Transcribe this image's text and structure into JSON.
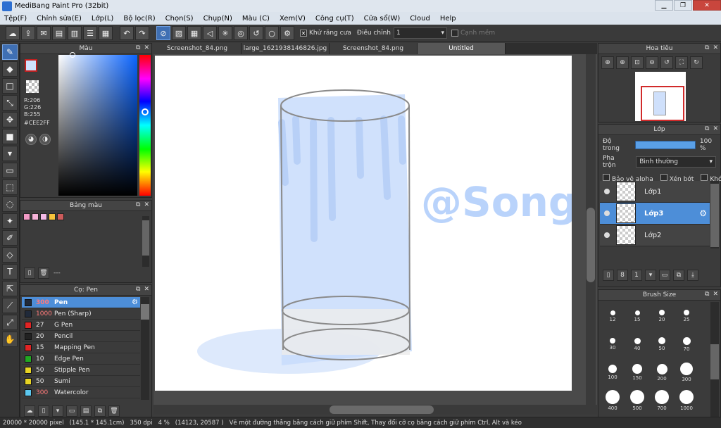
{
  "window": {
    "title": "MediBang Paint Pro (32bit)",
    "minimize": "▁",
    "maximize": "❐",
    "close": "✕"
  },
  "menu": [
    "Tệp(F)",
    "Chỉnh sửa(E)",
    "Lớp(L)",
    "Bộ lọc(R)",
    "Chọn(S)",
    "Chụp(N)",
    "Màu (C)",
    "Xem(V)",
    "Công cụ(T)",
    "Cửa sổ(W)",
    "Cloud",
    "Help"
  ],
  "toolbar": {
    "antialias_label": "Khử răng cưa",
    "correction_label": "Điều chỉnh",
    "correction_value": "1",
    "soft_edge_label": "Cạnh mềm"
  },
  "color_panel": {
    "title": "Màu",
    "r": "R:206",
    "g": "G:226",
    "b": "B:255",
    "hex": "#CEE2FF",
    "fg_color": "#CEE2FF"
  },
  "palette_panel": {
    "title": "Bảng màu",
    "swatches": [
      "#f29ac5",
      "#f5b2d8",
      "#f3b9e6",
      "#f7c33b",
      "#cc5b5b"
    ],
    "footer_text": "---"
  },
  "brush_panel": {
    "title": "Cọ: Pen",
    "brushes": [
      {
        "size": "300",
        "name": "Pen",
        "color": "#202a3a"
      },
      {
        "size": "1000",
        "name": "Pen (Sharp)",
        "color": "#202a3a"
      },
      {
        "size": "27",
        "name": "G Pen",
        "color": "#e02424"
      },
      {
        "size": "20",
        "name": "Pencil",
        "color": "#222222"
      },
      {
        "size": "15",
        "name": "Mapping Pen",
        "color": "#e02424"
      },
      {
        "size": "10",
        "name": "Edge Pen",
        "color": "#22a822"
      },
      {
        "size": "50",
        "name": "Stipple Pen",
        "color": "#e8d424"
      },
      {
        "size": "50",
        "name": "Sumi",
        "color": "#e8d424"
      },
      {
        "size": "300",
        "name": "Watercolor",
        "color": "#5cc8f0"
      }
    ]
  },
  "tabs": [
    "Screenshot_84.png",
    "large_1621938146826.jpg",
    "Screenshot_84.png",
    "Untitled"
  ],
  "canvas": {
    "signature": "@Song"
  },
  "navigator": {
    "title": "Hoa tiêu"
  },
  "layer_panel": {
    "title": "Lớp",
    "opacity_label": "Độ trong",
    "opacity_value": "100 %",
    "blend_label": "Pha trộn",
    "blend_value": "Bình thường",
    "protect_alpha": "Bảo vệ alpha",
    "clipping": "Xén bớt",
    "lock": "Khóa",
    "layers": [
      "Lớp1",
      "Lớp3",
      "Lớp2"
    ]
  },
  "brush_size_panel": {
    "title": "Brush Size",
    "sizes": [
      "12",
      "15",
      "20",
      "25",
      "30",
      "40",
      "50",
      "70",
      "100",
      "150",
      "200",
      "300",
      "400",
      "500",
      "700",
      "1000"
    ]
  },
  "statusbar": {
    "size": "20000 * 20000 pixel",
    "cm": "(145.1 * 145.1cm)",
    "dpi": "350 dpi",
    "zoom": "4 %",
    "coords": "(14123, 20587 )",
    "hint": "Vẽ một đường thẳng bằng cách giữ phím Shift, Thay đổi cỡ cọ bằng cách giữ phím Ctrl, Alt và kéo"
  }
}
